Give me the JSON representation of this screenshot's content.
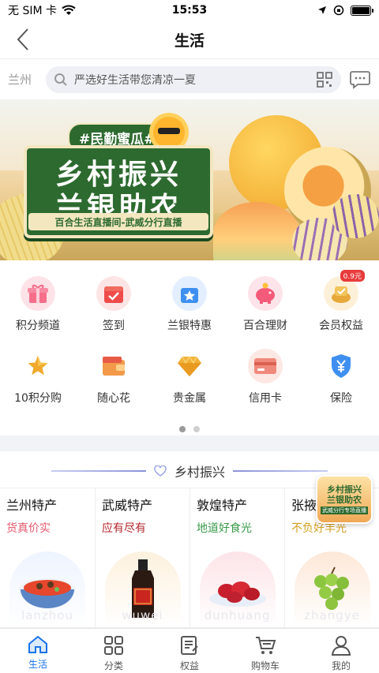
{
  "status_bar": {
    "carrier": "无 SIM 卡",
    "time": "15:53"
  },
  "navbar": {
    "title": "生活"
  },
  "search": {
    "city": "兰州",
    "placeholder": "严选好生活带您清凉一夏"
  },
  "banner": {
    "hashtag": "#民勤蜜瓜#",
    "headline_1": "乡村振兴",
    "headline_2": "兰银助农",
    "strip": "百合生活直播间-武威分行直播"
  },
  "grid": [
    {
      "label": "积分频道",
      "icon": "gift-icon",
      "color": "#f56f8b"
    },
    {
      "label": "签到",
      "icon": "checkin-calendar-icon",
      "color": "#ef4b4b"
    },
    {
      "label": "兰银特惠",
      "icon": "star-gift-box-icon",
      "color": "#3d8ff2"
    },
    {
      "label": "百合理财",
      "icon": "piggy-bank-icon",
      "color": "#f45a7a"
    },
    {
      "label": "会员权益",
      "icon": "crown-coin-icon",
      "color": "#e6a93a",
      "badge": "0.9元"
    },
    {
      "label": "10积分购",
      "icon": "star-icon",
      "color": "#f0a92c"
    },
    {
      "label": "随心花",
      "icon": "wallet-icon",
      "color": "#f29a4a"
    },
    {
      "label": "贵金属",
      "icon": "gold-diamond-icon",
      "color": "#f2b23a"
    },
    {
      "label": "信用卡",
      "icon": "credit-card-icon",
      "color": "#f08a7c"
    },
    {
      "label": "保险",
      "icon": "yuan-shield-icon",
      "color": "#3f8ff0"
    }
  ],
  "section": {
    "title": "乡村振兴"
  },
  "products": [
    {
      "name": "兰州特产",
      "sub": "货真价实",
      "sub_color": "#e55a6e",
      "pinyin": "lanzhou"
    },
    {
      "name": "武威特产",
      "sub": "应有尽有",
      "sub_color": "#b3262b",
      "pinyin": "wuwei"
    },
    {
      "name": "敦煌特产",
      "sub": "地道好食光",
      "sub_color": "#3a9a4c",
      "pinyin": "dunhuang"
    },
    {
      "name": "张掖特产",
      "sub": "不负好丰光",
      "sub_color": "#d4a021",
      "pinyin": "zhangye"
    }
  ],
  "float_ad": {
    "line1": "乡村振兴",
    "line2": "兰银助农",
    "line3": "武威分行专场直播"
  },
  "tabbar": [
    {
      "label": "生活",
      "icon": "home-icon",
      "active": true
    },
    {
      "label": "分类",
      "icon": "grid-icon",
      "active": false
    },
    {
      "label": "权益",
      "icon": "document-icon",
      "active": false
    },
    {
      "label": "购物车",
      "icon": "cart-icon",
      "active": false
    },
    {
      "label": "我的",
      "icon": "person-icon",
      "active": false
    }
  ]
}
